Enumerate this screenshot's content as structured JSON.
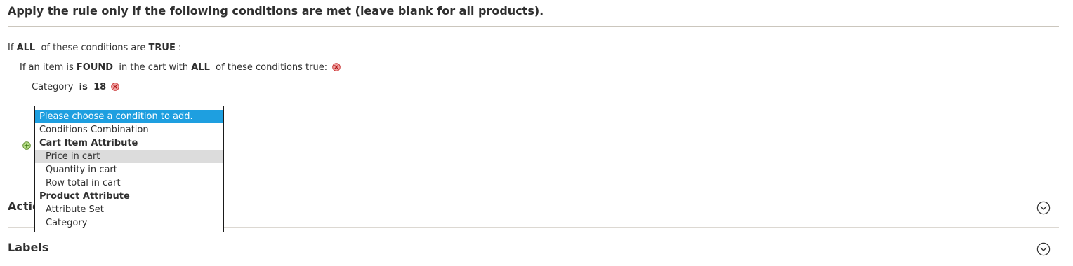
{
  "header": {
    "title": "Apply the rule only if the following conditions are met (leave blank for all products)."
  },
  "conditions": {
    "root": {
      "prefix": "If",
      "aggregator": "ALL",
      "middle": "of these conditions are",
      "value": "TRUE",
      "suffix": ":"
    },
    "found": {
      "prefix": "If an item is",
      "found_value": "FOUND",
      "middle": "in the cart with",
      "aggregator": "ALL",
      "suffix": "of these conditions true:"
    },
    "category_condition": {
      "attribute": "Category",
      "operator": "is",
      "value": "18"
    }
  },
  "dropdown": {
    "items": [
      {
        "label": "Please choose a condition to add.",
        "type": "option",
        "state": "selected"
      },
      {
        "label": "Conditions Combination",
        "type": "option"
      },
      {
        "label": "Cart Item Attribute",
        "type": "group"
      },
      {
        "label": "Price in cart",
        "type": "option",
        "state": "hovered"
      },
      {
        "label": "Quantity in cart",
        "type": "option"
      },
      {
        "label": "Row total in cart",
        "type": "option"
      },
      {
        "label": "Product Attribute",
        "type": "group"
      },
      {
        "label": "Attribute Set",
        "type": "option"
      },
      {
        "label": "Category",
        "type": "option"
      }
    ]
  },
  "accordions": {
    "actions_label": "Actions",
    "labels_label": "Labels"
  },
  "icons": {
    "remove": "remove-circle-icon",
    "add": "add-circle-icon",
    "expand": "chevron-down-circle-icon"
  },
  "colors": {
    "selected_bg": "#1e9fe0",
    "hover_bg": "#dcdcdc",
    "remove_red": "#e22626",
    "add_green": "#79a22e"
  }
}
